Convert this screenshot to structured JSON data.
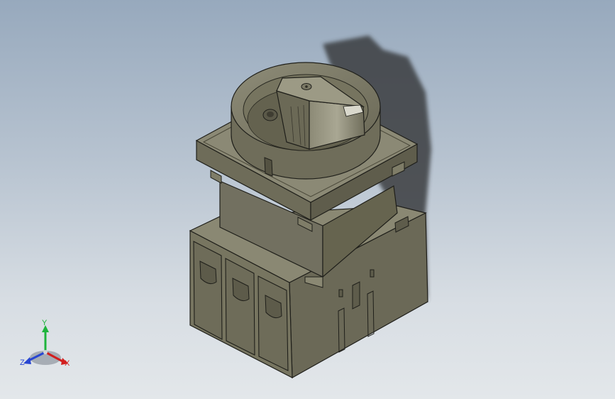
{
  "scene": {
    "model": "rotary-isolator-switch-3-pole",
    "background": {
      "top": "#97a9bd",
      "bottom": "#e3e7ea"
    },
    "colors": {
      "body_light": "#7f7d68",
      "body_mid": "#6c6a57",
      "body_dark": "#5a584a",
      "edge": "#1f1f1a",
      "shadow": "#3a3c40"
    }
  },
  "triad": {
    "x_label": "X",
    "y_label": "Y",
    "z_label": "Z",
    "x_color": "#d21e1e",
    "y_color": "#1eb43c",
    "z_color": "#2846d2"
  }
}
